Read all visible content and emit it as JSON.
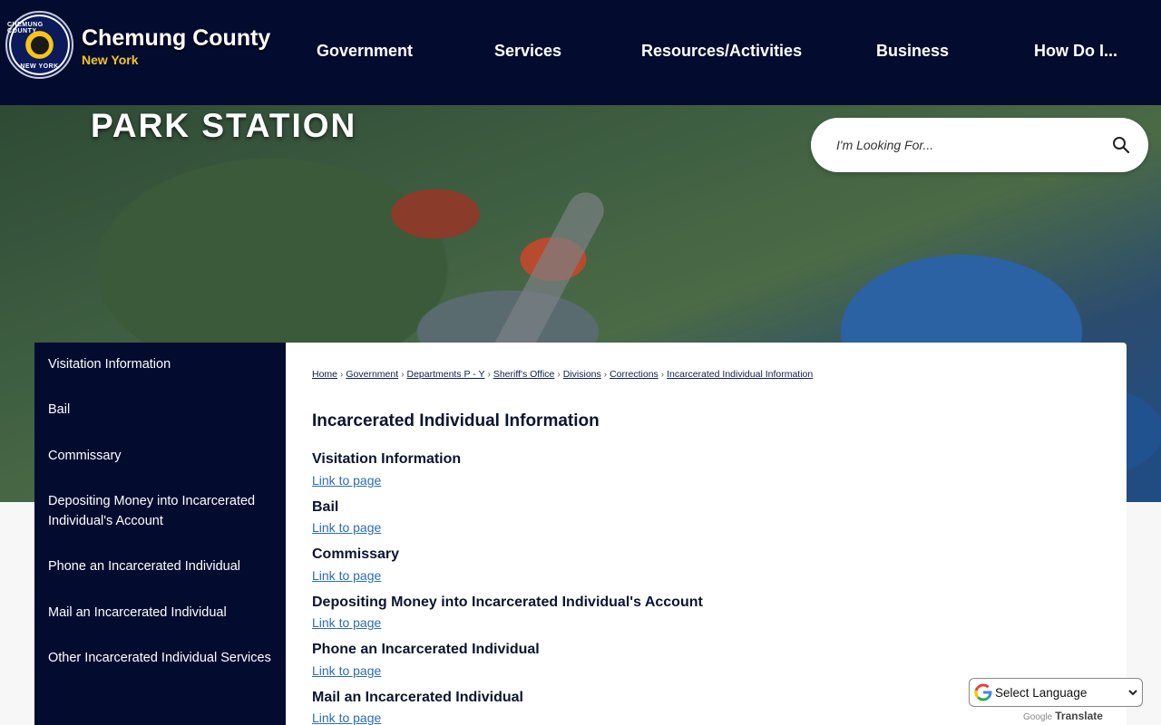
{
  "header": {
    "seal": {
      "ring_top": "CHEMUNG COUNTY",
      "ring_bottom": "NEW YORK"
    },
    "brand_name": "Chemung County",
    "brand_sub": "New York",
    "nav": [
      "Government",
      "Services",
      "Resources/Activities",
      "Business",
      "How Do I..."
    ]
  },
  "hero": {
    "title": "PARK STATION"
  },
  "search": {
    "placeholder": "I'm Looking For..."
  },
  "sidebar": {
    "items": [
      "Visitation Information",
      "Bail",
      "Commissary",
      "Depositing Money into Incarcerated Individual's Account",
      "Phone an Incarcerated Individual",
      "Mail an Incarcerated Individual",
      "Other Incarcerated Individual Services"
    ]
  },
  "breadcrumb": [
    "Home",
    "Government",
    "Departments P - Y",
    "Sheriff's Office",
    "Divisions",
    "Corrections",
    "Incarcerated Individual Information"
  ],
  "main": {
    "title": "Incarcerated Individual Information",
    "link_text": "Link to page",
    "entries": [
      "Visitation Information",
      "Bail",
      "Commissary",
      "Depositing Money into Incarcerated Individual's Account",
      "Phone an Incarcerated Individual",
      "Mail an Incarcerated Individual"
    ]
  },
  "translate": {
    "label": "Select Language",
    "powered_by": "Google",
    "brand": "Translate"
  },
  "colors": {
    "navy": "#030b2f",
    "gold": "#f5c518",
    "link": "#2a6db0"
  }
}
